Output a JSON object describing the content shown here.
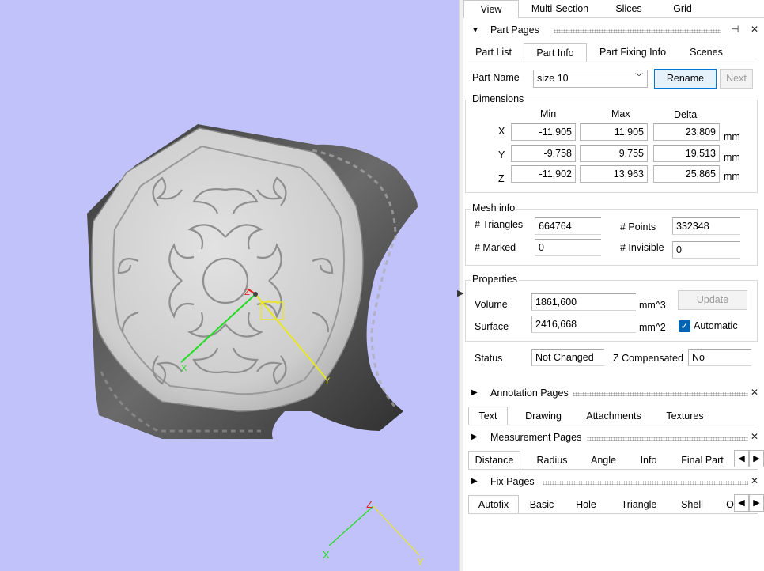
{
  "top_tabs": [
    "View",
    "Multi-Section",
    "Slices",
    "Grid"
  ],
  "part_pages": {
    "title": "Part Pages",
    "tabs": [
      "Part List",
      "Part Info",
      "Part Fixing Info",
      "Scenes"
    ],
    "part_name_label": "Part Name",
    "part_name_value": "size 10",
    "rename_label": "Rename",
    "next_label": "Next",
    "dimensions": {
      "title": "Dimensions",
      "headers": [
        "Min",
        "Max",
        "Delta"
      ],
      "rows": [
        {
          "axis": "X",
          "min": "-11,905",
          "max": "11,905",
          "delta": "23,809",
          "unit": "mm"
        },
        {
          "axis": "Y",
          "min": "-9,758",
          "max": "9,755",
          "delta": "19,513",
          "unit": "mm"
        },
        {
          "axis": "Z",
          "min": "-11,902",
          "max": "13,963",
          "delta": "25,865",
          "unit": "mm"
        }
      ]
    },
    "mesh_info": {
      "title": "Mesh info",
      "triangles_label": "# Triangles",
      "triangles": "664764",
      "points_label": "# Points",
      "points": "332348",
      "marked_label": "# Marked",
      "marked": "0",
      "invisible_label": "# Invisible",
      "invisible": "0"
    },
    "properties": {
      "title": "Properties",
      "volume_label": "Volume",
      "volume": "1861,600",
      "volume_unit": "mm^3",
      "surface_label": "Surface",
      "surface": "2416,668",
      "surface_unit": "mm^2",
      "update_label": "Update",
      "automatic_label": "Automatic",
      "automatic_checked": true
    },
    "status_label": "Status",
    "status_value": "Not Changed",
    "zcomp_label": "Z Compensated",
    "zcomp_value": "No"
  },
  "annotation_pages": {
    "title": "Annotation Pages",
    "tabs": [
      "Text",
      "Drawing",
      "Attachments",
      "Textures"
    ]
  },
  "measurement_pages": {
    "title": "Measurement Pages",
    "tabs": [
      "Distance",
      "Radius",
      "Angle",
      "Info",
      "Final Part"
    ]
  },
  "fix_pages": {
    "title": "Fix Pages",
    "tabs": [
      "Autofix",
      "Basic",
      "Hole",
      "Triangle",
      "Shell",
      "O"
    ]
  },
  "viewport": {
    "axis_labels": {
      "x": "X",
      "y": "Y",
      "z": "Z"
    },
    "colors": {
      "background": "#c2c2fb",
      "x_axis": "#22dd22",
      "y_axis": "#e8e820",
      "z_axis": "#e02020"
    }
  },
  "icons": {
    "collapse": "triangle-down-icon",
    "expand": "triangle-right-icon",
    "pin": "pin-icon",
    "close": "close-icon",
    "dropdown": "chevron-down-icon",
    "check": "check-icon",
    "scroll_left": "triangle-left-icon",
    "scroll_right": "triangle-right-icon"
  }
}
